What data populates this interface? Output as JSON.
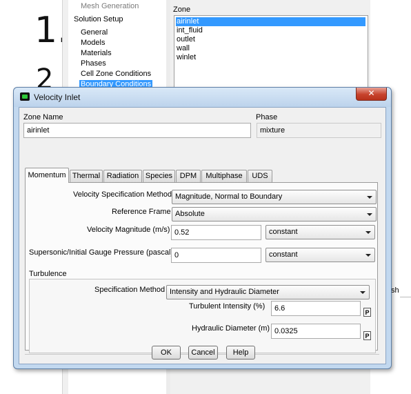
{
  "background": {
    "doc_glyphs": [
      "1.",
      "2"
    ],
    "tree_items": [
      {
        "label": "Mesh Generation",
        "state": "gray"
      },
      {
        "label": "Solution Setup",
        "state": "normal"
      },
      {
        "label": "General",
        "state": "normal"
      },
      {
        "label": "Models",
        "state": "normal"
      },
      {
        "label": "Materials",
        "state": "normal"
      },
      {
        "label": "Phases",
        "state": "normal"
      },
      {
        "label": "Cell Zone Conditions",
        "state": "normal"
      },
      {
        "label": "Boundary Conditions",
        "state": "selected"
      }
    ],
    "zone_label": "Zone",
    "zones": [
      "airinlet",
      "int_fluid",
      "outlet",
      "wall",
      "winlet"
    ],
    "selected_zone": "airinlet",
    "right_partial_text": "sh"
  },
  "dialog": {
    "title": "Velocity Inlet",
    "close_glyph": "✕",
    "zone_name_label": "Zone Name",
    "zone_name_value": "airinlet",
    "phase_label": "Phase",
    "phase_value": "mixture",
    "tabs": [
      "Momentum",
      "Thermal",
      "Radiation",
      "Species",
      "DPM",
      "Multiphase",
      "UDS"
    ],
    "active_tab": "Momentum",
    "momentum": {
      "velocity_spec_label": "Velocity Specification Method",
      "velocity_spec_value": "Magnitude, Normal to Boundary",
      "reference_frame_label": "Reference Frame",
      "reference_frame_value": "Absolute",
      "velocity_mag_label": "Velocity Magnitude (m/s)",
      "velocity_mag_value": "0.52",
      "velocity_mag_profile": "constant",
      "pressure_label": "Supersonic/Initial Gauge Pressure (pascal)",
      "pressure_value": "0",
      "pressure_profile": "constant",
      "turbulence_label": "Turbulence",
      "turb_spec_label": "Specification Method",
      "turb_spec_value": "Intensity and Hydraulic Diameter",
      "intensity_label": "Turbulent Intensity (%)",
      "intensity_value": "6.6",
      "hyd_diam_label": "Hydraulic Diameter (m)",
      "hyd_diam_value": "0.0325",
      "param_button": "P"
    },
    "buttons": {
      "ok": "OK",
      "cancel": "Cancel",
      "help": "Help"
    }
  }
}
